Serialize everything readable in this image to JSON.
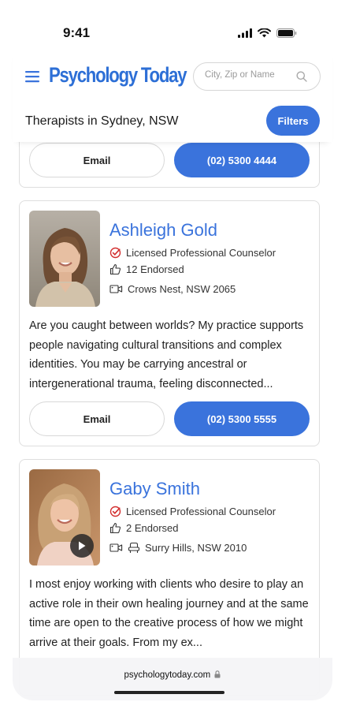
{
  "status": {
    "time": "9:41"
  },
  "header": {
    "logo": "Psychology Today",
    "search_placeholder": "City, Zip or Name",
    "page_title": "Therapists in Sydney, NSW",
    "filters_label": "Filters"
  },
  "cards": [
    {
      "email_label": "Email",
      "phone_label": "(02) 5300 4444"
    },
    {
      "name": "Ashleigh Gold",
      "credential": "Licensed Professional Counselor",
      "endorsed": "12 Endorsed",
      "location": "Crows Nest, NSW 2065",
      "bio": "Are you caught between worlds? My practice supports people navigating cultural transitions and complex identities. You may be carrying ancestral or intergenerational trauma, feeling disconnected...",
      "email_label": "Email",
      "phone_label": "(02) 5300 5555"
    },
    {
      "name": "Gaby Smith",
      "credential": "Licensed Professional Counselor",
      "endorsed": "2 Endorsed",
      "location": "Surry Hills, NSW 2010",
      "bio": "I most enjoy working with clients who desire to play an active role in their own healing journey and at the same time are open to the creative process of how we might arrive at their goals. From my ex..."
    }
  ],
  "browser": {
    "url": "psychologytoday.com"
  },
  "colors": {
    "accent": "#3a73dc"
  }
}
